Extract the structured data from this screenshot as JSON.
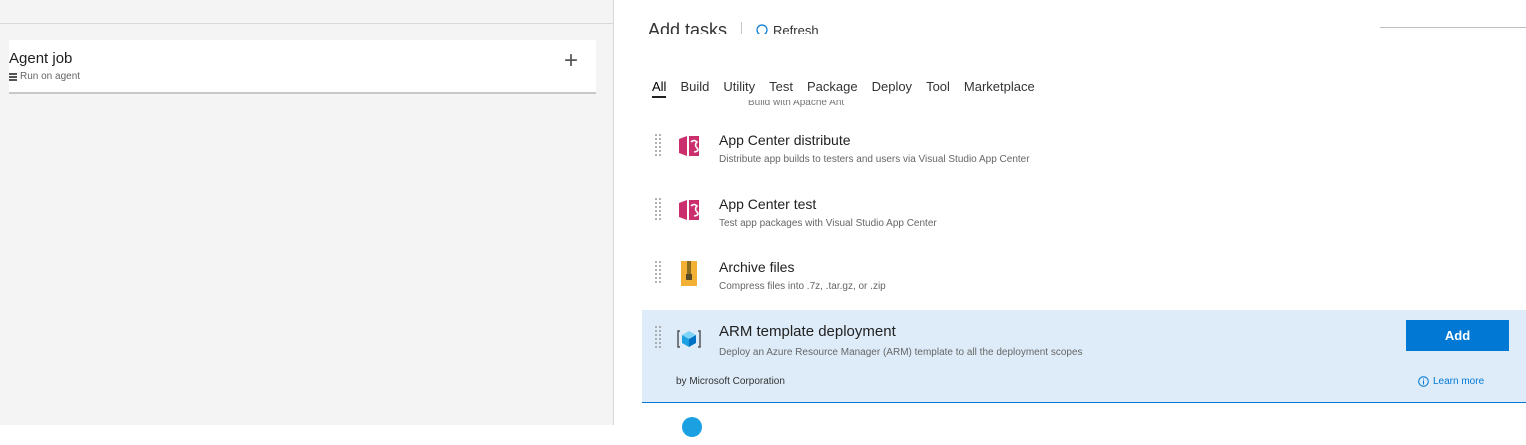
{
  "phase": {
    "title": "Agent job",
    "subtitle": "Run on agent"
  },
  "header": {
    "title": "Add tasks",
    "refresh_label": "Refresh"
  },
  "tabs": [
    {
      "label": "All",
      "active": true
    },
    {
      "label": "Build"
    },
    {
      "label": "Utility"
    },
    {
      "label": "Test"
    },
    {
      "label": "Package"
    },
    {
      "label": "Deploy"
    },
    {
      "label": "Tool"
    },
    {
      "label": "Marketplace"
    }
  ],
  "truncated_prev_desc": "Build with Apache Ant",
  "tasks": [
    {
      "name": "App Center distribute",
      "description": "Distribute app builds to testers and users via Visual Studio App Center",
      "icon": "app-center-icon"
    },
    {
      "name": "App Center test",
      "description": "Test app packages with Visual Studio App Center",
      "icon": "app-center-icon"
    },
    {
      "name": "Archive files",
      "description": "Compress files into .7z, .tar.gz, or .zip",
      "icon": "archive-icon"
    },
    {
      "name": "ARM template deployment",
      "description": "Deploy an Azure Resource Manager (ARM) template to all the deployment scopes",
      "icon": "arm-cube-icon",
      "publisher": "by Microsoft Corporation",
      "add_label": "Add",
      "learn_more_label": "Learn more"
    }
  ],
  "colors": {
    "accent": "#0078d4",
    "selected_bg": "#deecf9",
    "app_center": "#cb2e6d",
    "archive": "#f2b035"
  }
}
